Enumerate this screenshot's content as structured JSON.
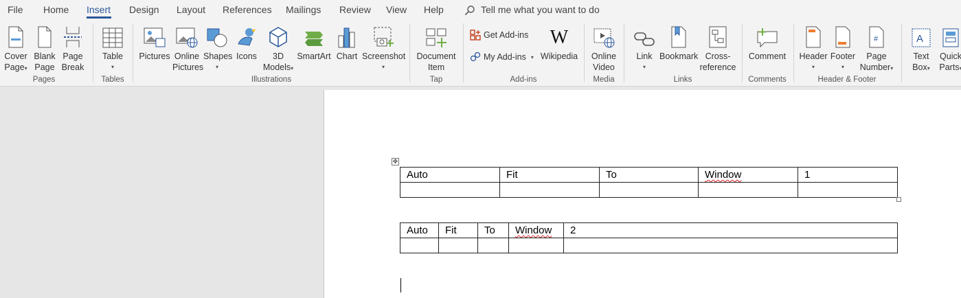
{
  "menu": {
    "tabs": [
      "File",
      "Home",
      "Insert",
      "Design",
      "Layout",
      "References",
      "Mailings",
      "Review",
      "View",
      "Help"
    ],
    "active_tab": "Insert",
    "tell_me": "Tell me what you want to do"
  },
  "ribbon": {
    "pages": {
      "group": "Pages",
      "cover": "Cover",
      "cover2": "Page",
      "blank": "Blank",
      "blank2": "Page",
      "break": "Page",
      "break2": "Break"
    },
    "tables": {
      "group": "Tables",
      "table": "Table"
    },
    "illustrations": {
      "group": "Illustrations",
      "pictures": "Pictures",
      "online": "Online",
      "online2": "Pictures",
      "shapes": "Shapes",
      "icons": "Icons",
      "models": "3D",
      "models2": "Models",
      "smartart": "SmartArt",
      "chart": "Chart",
      "screenshot": "Screenshot"
    },
    "tap": {
      "group": "Tap",
      "doc": "Document",
      "doc2": "Item"
    },
    "addins": {
      "group": "Add-ins",
      "get": "Get Add-ins",
      "my": "My Add-ins",
      "wikipedia": "Wikipedia"
    },
    "media": {
      "group": "Media",
      "video": "Online",
      "video2": "Video"
    },
    "links": {
      "group": "Links",
      "link": "Link",
      "bookmark": "Bookmark",
      "cross": "Cross-",
      "cross2": "reference"
    },
    "comments": {
      "group": "Comments",
      "comment": "Comment"
    },
    "header_footer": {
      "group": "Header & Footer",
      "header": "Header",
      "footer": "Footer",
      "pagenum": "Page",
      "pagenum2": "Number"
    },
    "text": {
      "textbox": "Text",
      "textbox2": "Box",
      "quick": "Quick",
      "quick2": "Parts"
    }
  },
  "document": {
    "table1": {
      "row1": [
        "Auto",
        "Fit",
        "To",
        "Window",
        "1"
      ],
      "row2": [
        "",
        "",
        "",
        "",
        ""
      ]
    },
    "table2": {
      "row1": [
        "Auto",
        "Fit",
        "To",
        "Window",
        "2"
      ],
      "row2": [
        "",
        "",
        "",
        "",
        ""
      ]
    }
  },
  "colors": {
    "accent": "#2b579a",
    "ribbon_bg": "#f3f3f3",
    "canvas_bg": "#e6e6e6",
    "spell_error": "#dd2222"
  }
}
